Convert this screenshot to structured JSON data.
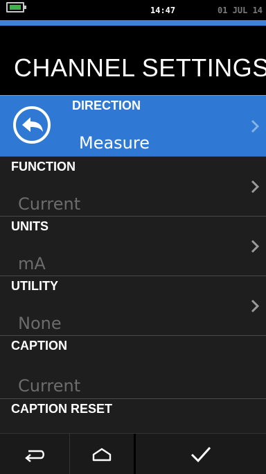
{
  "status": {
    "time": "14:47",
    "date": "01 JUL 14"
  },
  "title": "CHANNEL SETTINGS",
  "rows": [
    {
      "label": "DIRECTION",
      "value": "Measure",
      "selected": true
    },
    {
      "label": "FUNCTION",
      "value": "Current"
    },
    {
      "label": "UNITS",
      "value": "mA"
    },
    {
      "label": "UTILITY",
      "value": "None"
    },
    {
      "label": "CAPTION",
      "value": "Current"
    },
    {
      "label": "CAPTION RESET"
    }
  ],
  "icons": {
    "battery": "battery-charging-icon",
    "direction": "back-arrow-circle-icon",
    "chevron": "chevron-right-icon",
    "nav_back": "undo-arrow-icon",
    "nav_home": "home-icon",
    "nav_ok": "checkmark-icon"
  },
  "colors": {
    "accent": "#3b82d8",
    "selected_row": "#2f78d3",
    "battery": "#3fb34f",
    "value_text": "#6c6c6c"
  }
}
